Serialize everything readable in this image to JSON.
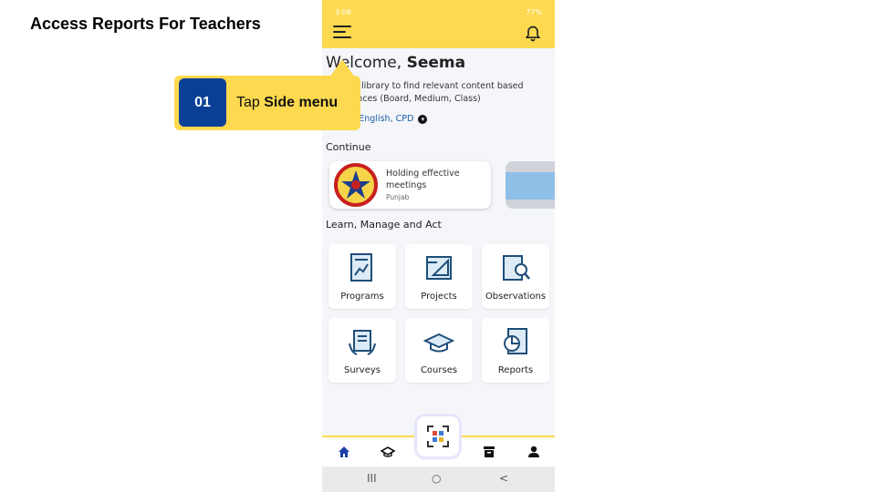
{
  "slide": {
    "title": "Access Reports For Teachers"
  },
  "status_bar": {
    "time": "3:08",
    "icons_text": "77%"
  },
  "header": {
    "menu_icon": "hamburger-menu-icon",
    "notification_icon": "bell-icon"
  },
  "welcome": {
    "greeting": "Welcome,",
    "name": "Seema"
  },
  "intro": {
    "text": "DIKSHA library to find relevant content based preferences (Board, Medium, Class)",
    "preferences": "unjab), English, CPD"
  },
  "continue_section": {
    "title": "Continue",
    "card": {
      "title": "Holding effective meetings",
      "subtitle": "Punjab"
    }
  },
  "learn_section": {
    "title": "Learn, Manage and Act",
    "tiles": [
      {
        "label": "Programs",
        "icon": "programs-icon"
      },
      {
        "label": "Projects",
        "icon": "projects-icon"
      },
      {
        "label": "Observations",
        "icon": "observations-icon"
      },
      {
        "label": "Surveys",
        "icon": "surveys-icon"
      },
      {
        "label": "Courses",
        "icon": "courses-icon"
      },
      {
        "label": "Reports",
        "icon": "reports-icon"
      }
    ]
  },
  "bottom_nav": {
    "items": [
      "home-icon",
      "graduation-cap-icon",
      "qr-scanner-icon",
      "archive-icon",
      "profile-icon"
    ],
    "active_color": "#1a3fa8"
  },
  "system_nav": {
    "recent": "III",
    "home": "○",
    "back": "<"
  },
  "callout": {
    "step": "01",
    "prefix": "Tap",
    "action": "Side menu"
  },
  "colors": {
    "accent_yellow": "#fdd94f",
    "badge_blue": "#0a3f96"
  }
}
